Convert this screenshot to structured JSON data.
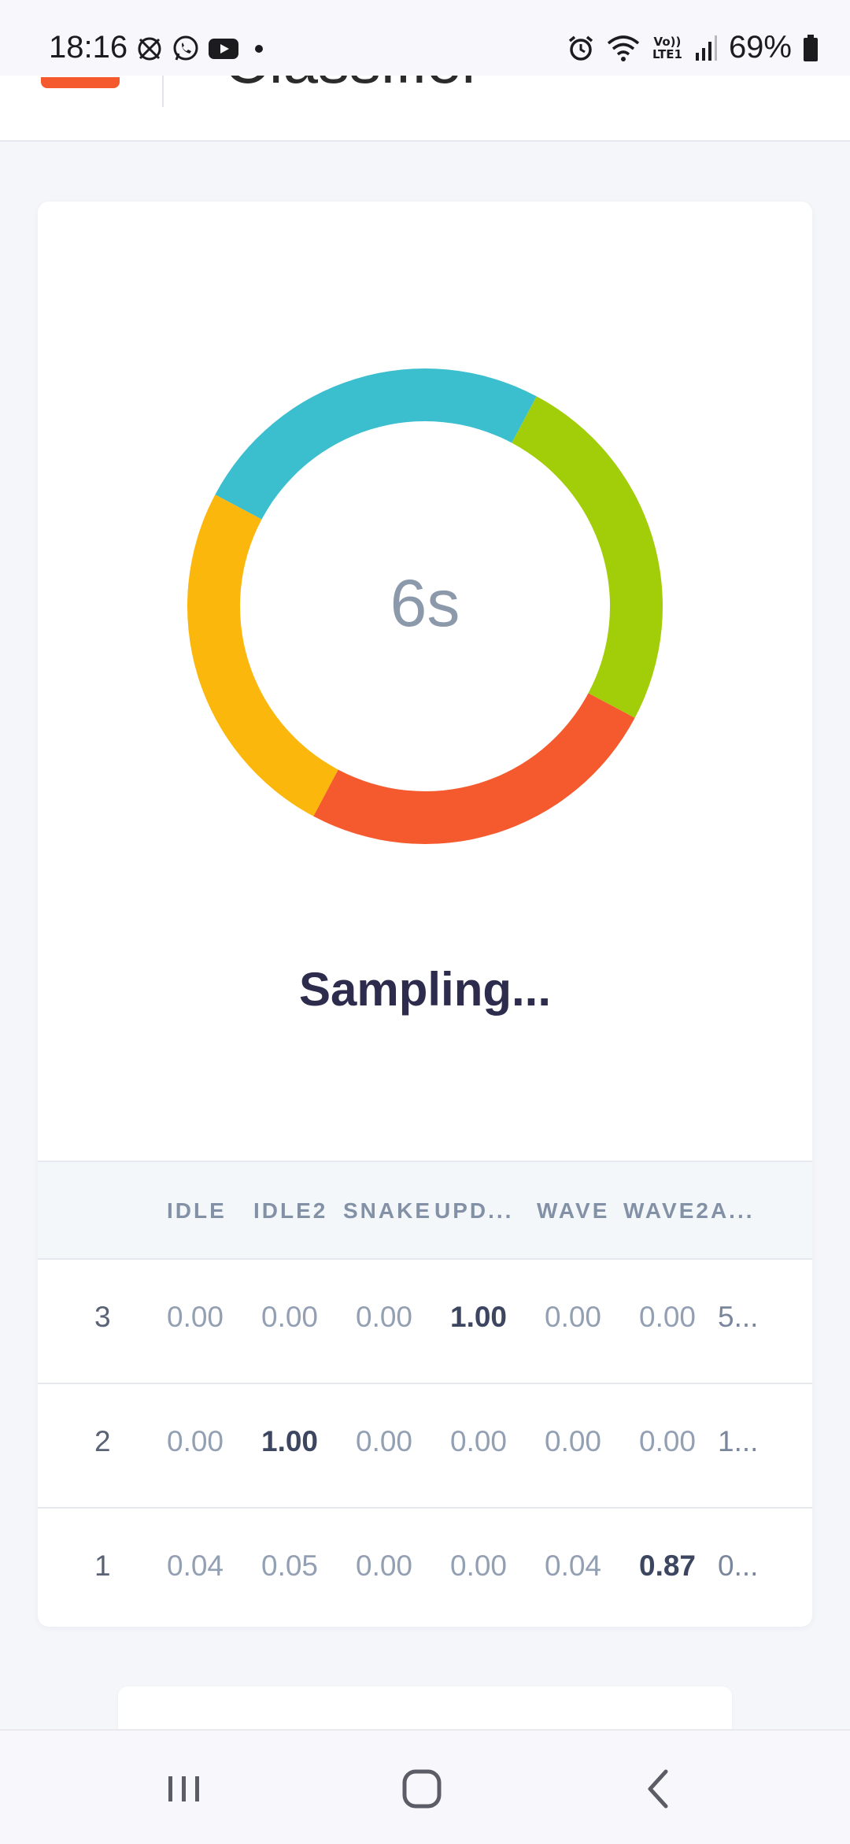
{
  "status_bar": {
    "time": "18:16",
    "battery_percent": "69%",
    "network_label": "Vo)) LTE1",
    "left_icons": [
      "muted-alarm-icon",
      "whatsapp-icon",
      "youtube-icon",
      "dot-icon"
    ],
    "right_icons": [
      "alarm-icon",
      "wifi-icon",
      "signal-icon",
      "battery-icon"
    ]
  },
  "header": {
    "title": "Classifier"
  },
  "classifier": {
    "timer": "6s",
    "status": "Sampling...",
    "ring_colors": [
      "#3bbfcf",
      "#a2cd09",
      "#f55a2e",
      "#fbb70c"
    ]
  },
  "table": {
    "columns": [
      "",
      "IDLE",
      "IDLE2",
      "SNAKE",
      "UPD...",
      "WAVE",
      "WAVE2A...",
      ""
    ],
    "rows": [
      {
        "index": "3",
        "values": [
          "0.00",
          "0.00",
          "0.00",
          "1.00",
          "0.00",
          "0.00"
        ],
        "extra": "5...",
        "highlight": 3
      },
      {
        "index": "2",
        "values": [
          "0.00",
          "1.00",
          "0.00",
          "0.00",
          "0.00",
          "0.00"
        ],
        "extra": "1...",
        "highlight": 1
      },
      {
        "index": "1",
        "values": [
          "0.04",
          "0.05",
          "0.00",
          "0.00",
          "0.04",
          "0.87"
        ],
        "extra": "0...",
        "highlight": 5
      }
    ]
  },
  "nav": {
    "icons": [
      "recents-icon",
      "home-icon",
      "back-icon"
    ]
  }
}
